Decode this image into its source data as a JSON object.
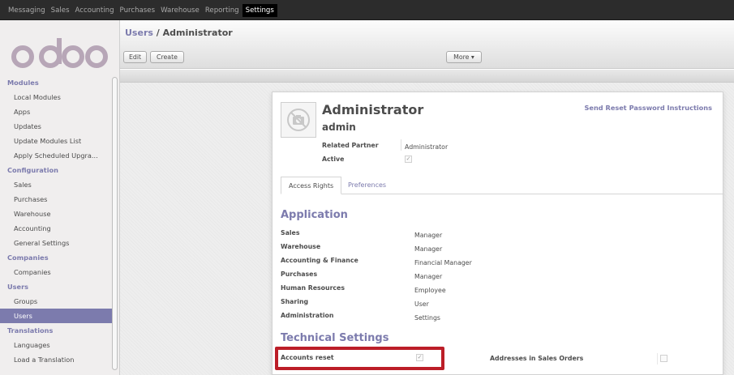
{
  "topbar": {
    "menu": [
      "Messaging",
      "Sales",
      "Accounting",
      "Purchases",
      "Warehouse",
      "Reporting",
      "Settings"
    ],
    "active": "Settings"
  },
  "logo": {
    "text": "odoo",
    "color": "#b7a6b7"
  },
  "sidebar": {
    "sections": [
      {
        "title": "Modules",
        "items": [
          "Local Modules",
          "Apps",
          "Updates",
          "Update Modules List",
          "Apply Scheduled Upgra..."
        ]
      },
      {
        "title": "Configuration",
        "items": [
          "Sales",
          "Purchases",
          "Warehouse",
          "Accounting",
          "General Settings"
        ]
      },
      {
        "title": "Companies",
        "items": [
          "Companies"
        ]
      },
      {
        "title": "Users",
        "items": [
          "Groups",
          "Users"
        ]
      },
      {
        "title": "Translations",
        "items": [
          "Languages",
          "Load a Translation"
        ]
      }
    ],
    "selected": "Users"
  },
  "header": {
    "breadcrumb_link": "Users",
    "breadcrumb_sep": " / ",
    "breadcrumb_current": "Administrator",
    "edit_label": "Edit",
    "create_label": "Create",
    "more_label": "More ▾"
  },
  "form": {
    "name": "Administrator",
    "login": "admin",
    "reset_link": "Send Reset Password Instructions",
    "related_partner_label": "Related Partner",
    "related_partner_value": "Administrator",
    "active_label": "Active",
    "active_checked": true,
    "tabs": [
      "Access Rights",
      "Preferences"
    ],
    "active_tab": "Access Rights",
    "application_title": "Application",
    "application_rows": [
      {
        "label": "Sales",
        "value": "Manager"
      },
      {
        "label": "Warehouse",
        "value": "Manager"
      },
      {
        "label": "Accounting & Finance",
        "value": "Financial Manager"
      },
      {
        "label": "Purchases",
        "value": "Manager"
      },
      {
        "label": "Human Resources",
        "value": "Employee"
      },
      {
        "label": "Sharing",
        "value": "User"
      },
      {
        "label": "Administration",
        "value": "Settings"
      }
    ],
    "technical_title": "Technical Settings",
    "technical_rows": [
      {
        "label": "Accounts reset",
        "checked": true
      },
      {
        "label": "Addresses in Sales Orders",
        "checked": false
      }
    ]
  },
  "colors": {
    "accent": "#7c7bad",
    "highlight": "#bc1e28",
    "topbar": "#2c2c2c"
  }
}
